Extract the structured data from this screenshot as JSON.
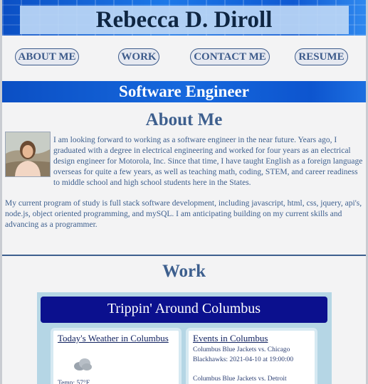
{
  "header": {
    "title": "Rebecca D. Diroll"
  },
  "nav": {
    "items": [
      {
        "label": "ABOUT ME"
      },
      {
        "label": "WORK"
      },
      {
        "label": "CONTACT ME"
      },
      {
        "label": "RESUME"
      }
    ]
  },
  "subtitle": "Software Engineer",
  "about": {
    "heading": "About Me",
    "paragraphs": [
      "I am looking forward to working as a software engineer in the near future. Years ago, I graduated with a degree in electrical engineering and worked for four years as an electrical design engineer for Motorola, Inc. Since that time, I have taught English as a foreign language overseas for quite a few years, as well as teaching math, coding, STEM, and career readiness to middle school and high school students here in the States.",
      "My current program of study is full stack software development, including javascript, html, css, jquery, api's, node.js, object oriented programming, and mySQL. I am anticipating building on my current skills and advancing as a programmer."
    ]
  },
  "work": {
    "heading": "Work",
    "preview": {
      "title": "Trippin' Around Columbus",
      "weather": {
        "title": "Today's Weather in Columbus",
        "icon": "cloud-icon",
        "temp": "Temp: 57°F"
      },
      "events": {
        "title": "Events in Columbus",
        "items": [
          "Columbus Blue Jackets vs. Chicago Blackhawks: 2021-04-10 at 19:00:00",
          "Columbus Blue Jackets vs. Detroit"
        ]
      }
    }
  },
  "colors": {
    "heading": "#3d5f8e",
    "banner": "#0b4fc4",
    "preview_header": "#0b108e"
  }
}
